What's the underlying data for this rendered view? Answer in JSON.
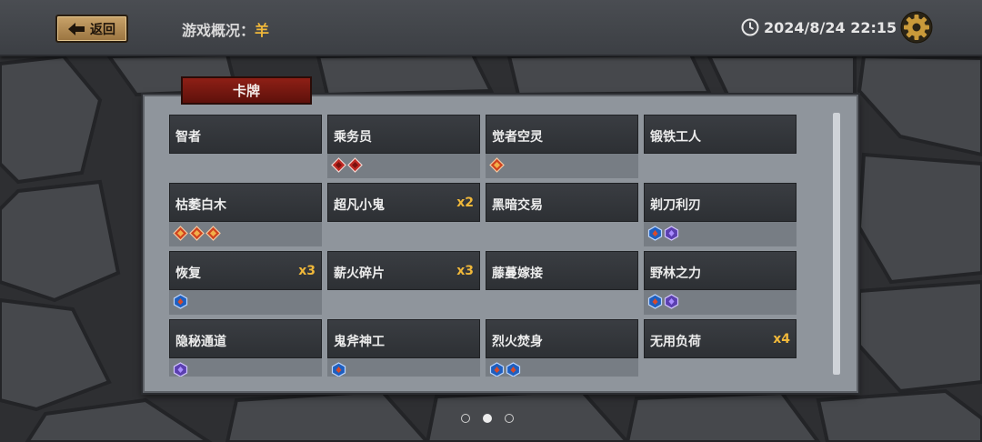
{
  "header": {
    "back_label": "返回",
    "title_prefix": "游戏概况：",
    "title_value": "羊",
    "datetime": "2024/8/24 22:15"
  },
  "panel": {
    "tab_label": "卡牌"
  },
  "cards": [
    {
      "name": "智者",
      "count": "",
      "badges": []
    },
    {
      "name": "乘务员",
      "count": "",
      "badges": [
        "red-diamond",
        "red-diamond"
      ]
    },
    {
      "name": "觉者空灵",
      "count": "",
      "badges": [
        "orange-diamond"
      ]
    },
    {
      "name": "锻铁工人",
      "count": "",
      "badges": []
    },
    {
      "name": "枯萎白木",
      "count": "",
      "badges": [
        "orange-diamond",
        "orange-diamond",
        "orange-diamond"
      ]
    },
    {
      "name": "超凡小鬼",
      "count": "x2",
      "badges": []
    },
    {
      "name": "黑暗交易",
      "count": "",
      "badges": []
    },
    {
      "name": "剃刀利刃",
      "count": "",
      "badges": [
        "blue-hex",
        "purple-hex"
      ]
    },
    {
      "name": "恢复",
      "count": "x3",
      "badges": [
        "blue-hex"
      ]
    },
    {
      "name": "薪火碎片",
      "count": "x3",
      "badges": []
    },
    {
      "name": "藤蔓嫁接",
      "count": "",
      "badges": []
    },
    {
      "name": "野林之力",
      "count": "",
      "badges": [
        "blue-hex",
        "purple-hex"
      ]
    },
    {
      "name": "隐秘通道",
      "count": "",
      "badges": [
        "purple-hex"
      ]
    },
    {
      "name": "鬼斧神工",
      "count": "",
      "badges": [
        "blue-hex"
      ]
    },
    {
      "name": "烈火焚身",
      "count": "",
      "badges": [
        "blue-hex",
        "blue-hex"
      ]
    },
    {
      "name": "无用负荷",
      "count": "x4",
      "badges": []
    }
  ],
  "pager": {
    "pages": 3,
    "active": 2
  },
  "colors": {
    "accent": "#f0b83a",
    "tab": "#8e1f16"
  }
}
